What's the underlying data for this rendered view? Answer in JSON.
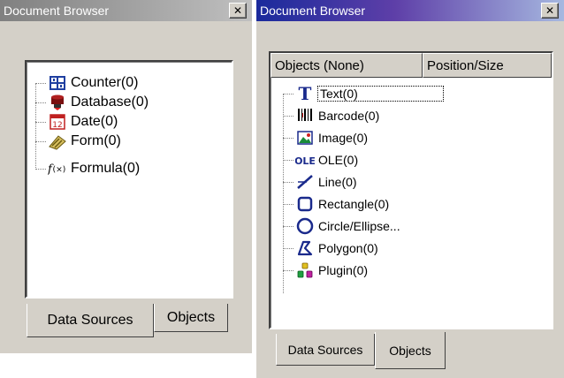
{
  "window_a": {
    "title": "Document Browser",
    "close_glyph": "✕",
    "items": [
      {
        "label": "Counter(0)",
        "icon": "counter-icon"
      },
      {
        "label": "Database(0)",
        "icon": "database-icon"
      },
      {
        "label": "Date(0)",
        "icon": "calendar-icon"
      },
      {
        "label": "Form(0)",
        "icon": "form-icon"
      },
      {
        "label": "Formula(0)",
        "icon": "formula-icon"
      }
    ],
    "tabs": [
      {
        "label": "Data Sources",
        "selected": true
      },
      {
        "label": "Objects",
        "selected": false
      }
    ]
  },
  "window_b": {
    "title": "Document Browser",
    "close_glyph": "✕",
    "columns": [
      "Objects (None)",
      "Position/Size"
    ],
    "items": [
      {
        "label": "Text(0)",
        "icon": "text-icon",
        "focused": true
      },
      {
        "label": "Barcode(0)",
        "icon": "barcode-icon"
      },
      {
        "label": "Image(0)",
        "icon": "image-icon"
      },
      {
        "label": "OLE(0)",
        "icon": "ole-icon"
      },
      {
        "label": "Line(0)",
        "icon": "line-icon"
      },
      {
        "label": "Rectangle(0)",
        "icon": "rectangle-icon"
      },
      {
        "label": "Circle/Ellipse...",
        "icon": "circle-icon"
      },
      {
        "label": "Polygon(0)",
        "icon": "polygon-icon"
      },
      {
        "label": "Plugin(0)",
        "icon": "plugin-icon"
      }
    ],
    "tabs": [
      {
        "label": "Data Sources",
        "selected": false
      },
      {
        "label": "Objects",
        "selected": true
      }
    ]
  }
}
